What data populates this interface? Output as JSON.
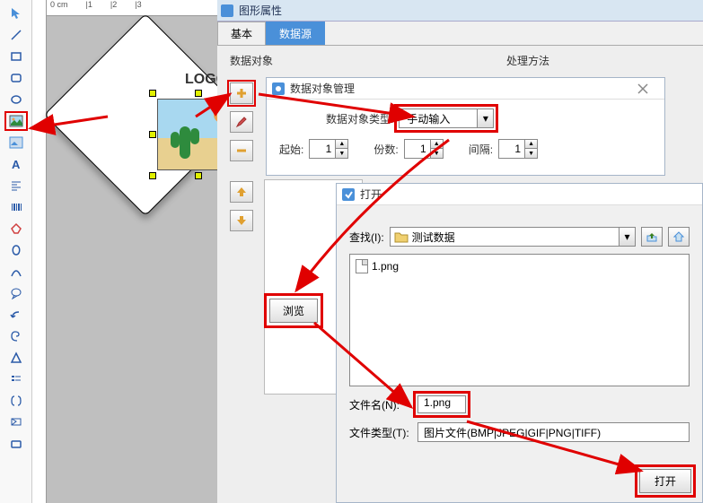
{
  "ruler": {
    "tick0": "0 cm",
    "tick1": "|1",
    "tick2": "|2",
    "tick3": "|3"
  },
  "canvas": {
    "logo_text": "LOGO"
  },
  "shape_panel": {
    "title": "图形属性",
    "tab_basic": "基本",
    "tab_datasource": "数据源",
    "section_data_object": "数据对象",
    "section_processing": "处理方法"
  },
  "dlg1": {
    "title": "数据对象管理",
    "label_type": "数据对象类型:",
    "type_value": "手动输入",
    "label_start": "起始:",
    "start_value": "1",
    "label_count": "份数:",
    "count_value": "1",
    "label_gap": "间隔:",
    "gap_value": "1",
    "browse_label": "浏览"
  },
  "dlg2": {
    "title": "打开",
    "lookin_label": "查找(I):",
    "lookin_value": "测试数据",
    "file_items": [
      "1.png"
    ],
    "filename_label": "文件名(N):",
    "filename_value": "1.png",
    "filetype_label": "文件类型(T):",
    "filetype_value": "图片文件(BMP|JPEG|GIF|PNG|TIFF)",
    "open_label": "打开"
  }
}
